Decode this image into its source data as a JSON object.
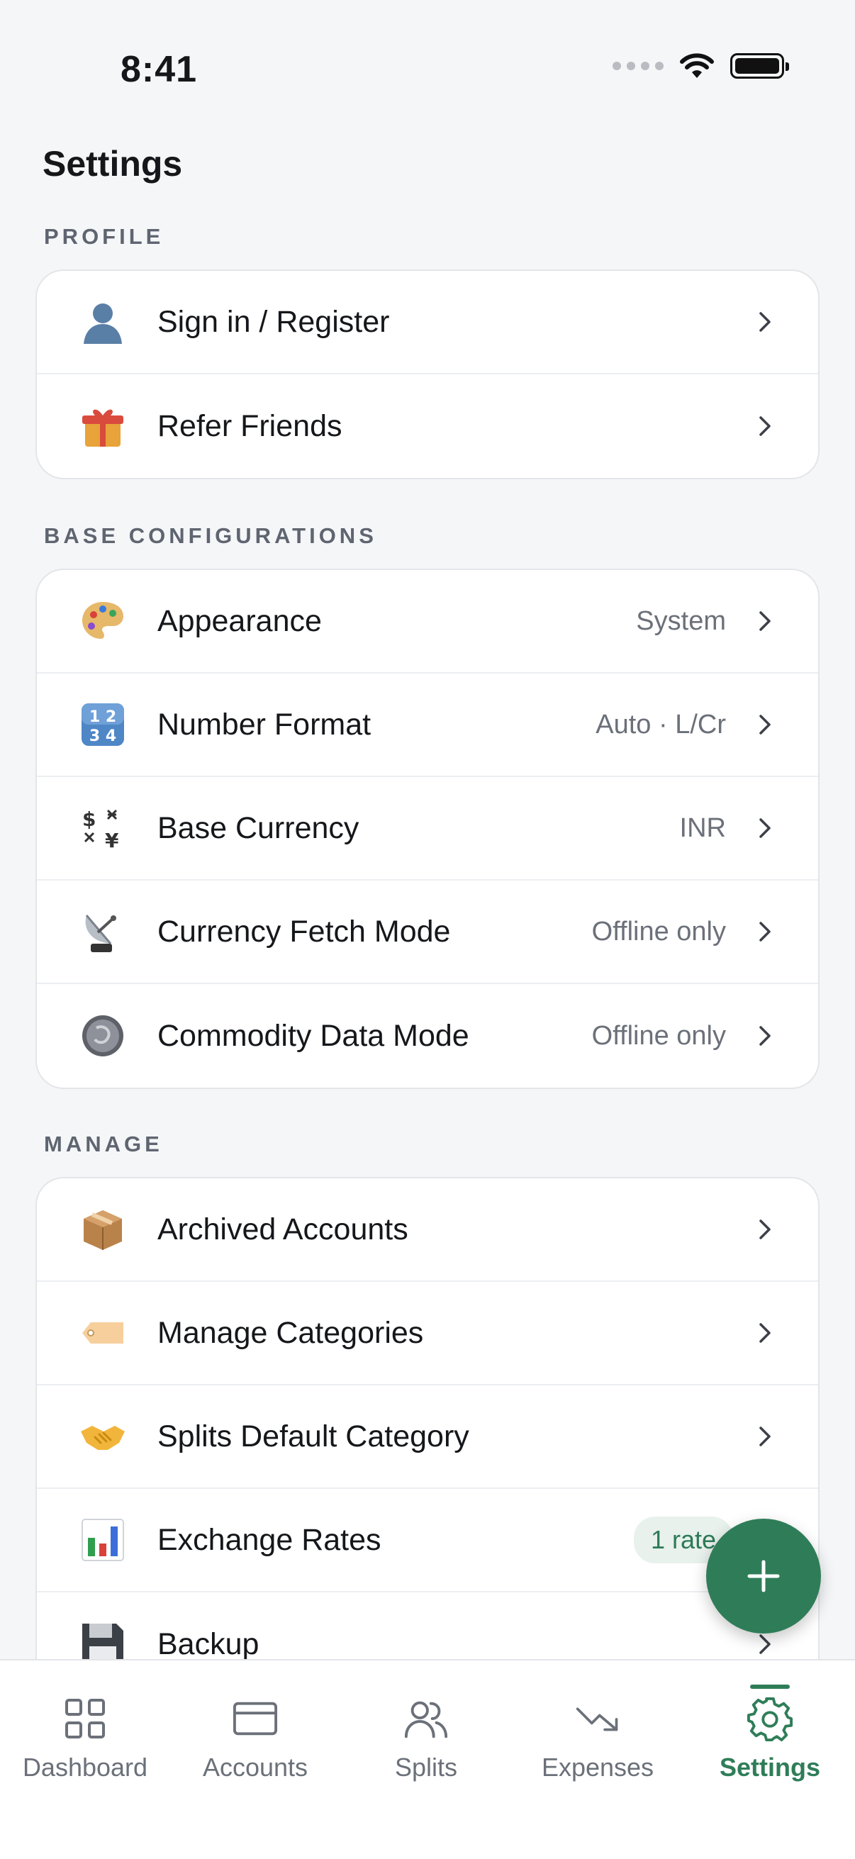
{
  "status_bar": {
    "time": "8:41"
  },
  "page": {
    "title": "Settings"
  },
  "sections": {
    "profile": {
      "label": "PROFILE",
      "items": [
        {
          "label": "Sign in / Register",
          "icon": "person-icon"
        },
        {
          "label": "Refer Friends",
          "icon": "gift-icon"
        }
      ]
    },
    "base": {
      "label": "BASE CONFIGURATIONS",
      "items": [
        {
          "label": "Appearance",
          "value": "System",
          "icon": "palette-icon"
        },
        {
          "label": "Number Format",
          "value": "Auto · L/Cr",
          "icon": "number-keys-icon"
        },
        {
          "label": "Base Currency",
          "value": "INR",
          "icon": "currency-exchange-icon"
        },
        {
          "label": "Currency Fetch Mode",
          "value": "Offline only",
          "icon": "satellite-dish-icon"
        },
        {
          "label": "Commodity Data Mode",
          "value": "Offline only",
          "icon": "coin-icon"
        }
      ]
    },
    "manage": {
      "label": "MANAGE",
      "items": [
        {
          "label": "Archived Accounts",
          "icon": "package-icon"
        },
        {
          "label": "Manage Categories",
          "icon": "tag-icon"
        },
        {
          "label": "Splits Default Category",
          "icon": "handshake-icon"
        },
        {
          "label": "Exchange Rates",
          "badge": "1 rate",
          "icon": "bar-chart-icon"
        },
        {
          "label": "Backup",
          "icon": "floppy-disk-icon"
        }
      ]
    }
  },
  "tabs": [
    {
      "label": "Dashboard",
      "icon": "grid-icon"
    },
    {
      "label": "Accounts",
      "icon": "card-icon"
    },
    {
      "label": "Splits",
      "icon": "users-icon"
    },
    {
      "label": "Expenses",
      "icon": "trending-down-icon"
    },
    {
      "label": "Settings",
      "icon": "gear-icon",
      "active": true
    }
  ],
  "colors": {
    "accent": "#2f7d58",
    "background": "#f5f6f8",
    "card": "#ffffff",
    "muted_text": "#6b7079"
  }
}
